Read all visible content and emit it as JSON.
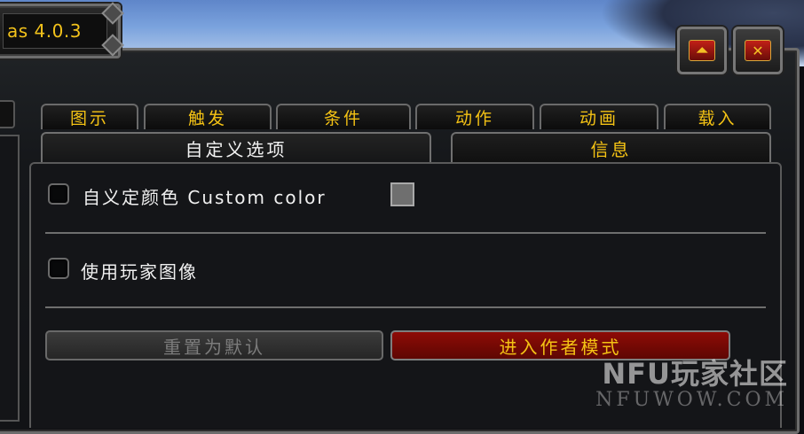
{
  "window": {
    "title": "as 4.0.3"
  },
  "window_controls": {
    "collapse_symbol": "⏶",
    "close_symbol": "✕"
  },
  "tabs": [
    {
      "label": "图示"
    },
    {
      "label": "触发"
    },
    {
      "label": "条件"
    },
    {
      "label": "动作"
    },
    {
      "label": "动画"
    },
    {
      "label": "载入"
    }
  ],
  "subtabs": [
    {
      "label": "自定义选项",
      "active": true
    },
    {
      "label": "信息",
      "active": false
    }
  ],
  "options": {
    "custom_color": {
      "label": "自义定颜色 Custom color",
      "checked": false,
      "swatch_color": "#6f6f6f"
    },
    "use_player_image": {
      "label": "使用玩家图像",
      "checked": false
    }
  },
  "buttons": {
    "reset_default": "重置为默认",
    "enter_author_mode": "进入作者模式"
  },
  "watermark": {
    "logo": "NFU玩家社区",
    "url": "NFUWOW.COM"
  },
  "colors": {
    "accent_gold": "#f4c214",
    "danger_red": "#8e0b06",
    "panel_bg": "#141518"
  }
}
